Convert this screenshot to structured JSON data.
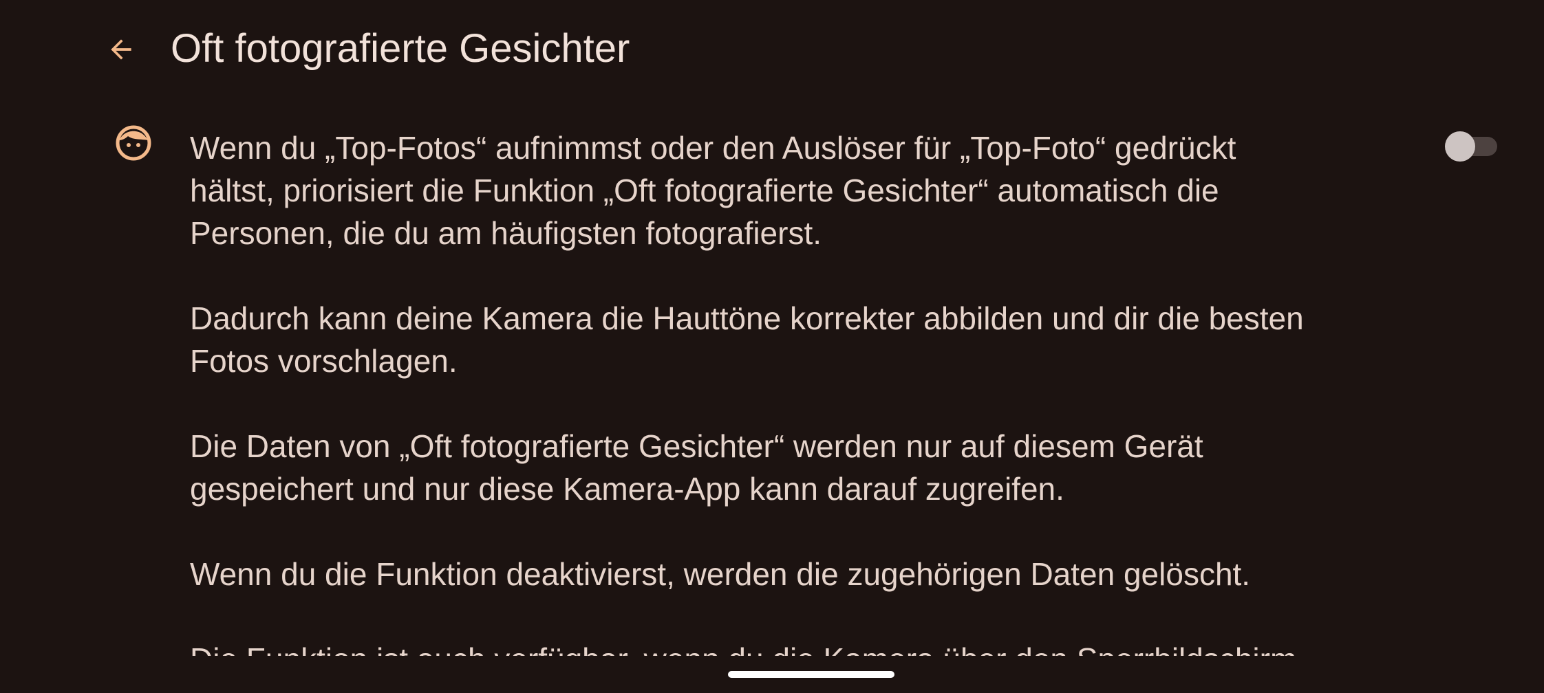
{
  "header": {
    "title": "Oft fotografierte Gesichter",
    "back_icon": "arrow-back-icon"
  },
  "setting": {
    "icon": "face-icon",
    "toggle_on": false,
    "paragraphs": [
      "Wenn du „Top-Fotos“ aufnimmst oder den Auslöser für „Top-Foto“ gedrückt\nhältst, priorisiert die Funktion „Oft fotografierte Gesichter“ automatisch die\nPersonen, die du am häufigsten fotografierst.",
      "Dadurch kann deine Kamera die Hauttöne korrekter abbilden und dir die besten\nFotos vorschlagen.",
      "Die Daten von „Oft fotografierte Gesichter“ werden nur auf diesem Gerät\ngespeichert und nur diese Kamera-App kann darauf zugreifen.",
      "Wenn du die Funktion deaktivierst, werden die zugehörigen Daten gelöscht.",
      "Die Funktion ist auch verfügbar, wenn du die Kamera über den Sperrbildschirm"
    ]
  },
  "colors": {
    "background": "#1c1311",
    "accent": "#f4b98a",
    "text": "#e6d4cb"
  }
}
